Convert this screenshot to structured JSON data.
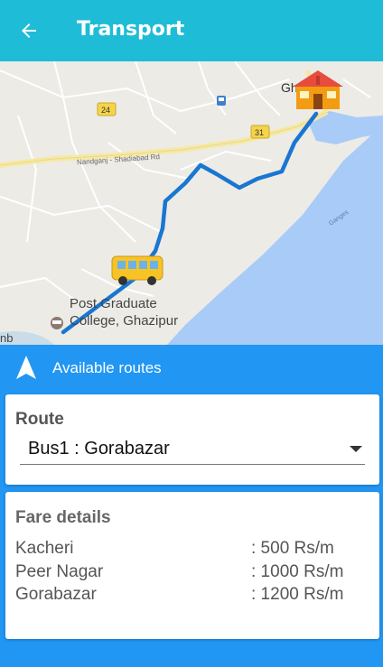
{
  "appbar": {
    "title": "Transport"
  },
  "map": {
    "labels": {
      "city": "Ghazipur",
      "road_name": "Nandganj - Shadiabad Rd",
      "highway_24": "24",
      "highway_31": "31",
      "river": "Ganges",
      "college_line1": "Post Graduate",
      "college_line2": "College, Ghazipur",
      "edge_fragment": "nb"
    },
    "colors": {
      "route": "#1976D2",
      "water": "#A9CBF8",
      "land": "#EDEBE6",
      "road_major": "#F6E9A5"
    }
  },
  "routes_bar": {
    "label": "Available routes",
    "icon": "navigation-arrow-icon"
  },
  "route_card": {
    "heading": "Route",
    "selected": "Bus1 : Gorabazar"
  },
  "fare_card": {
    "heading": "Fare details",
    "rows": [
      {
        "place": "Kacheri",
        "amount": ": 500 Rs/m"
      },
      {
        "place": "Peer Nagar",
        "amount": ": 1000 Rs/m"
      },
      {
        "place": "Gorabazar",
        "amount": ": 1200 Rs/m"
      }
    ]
  }
}
